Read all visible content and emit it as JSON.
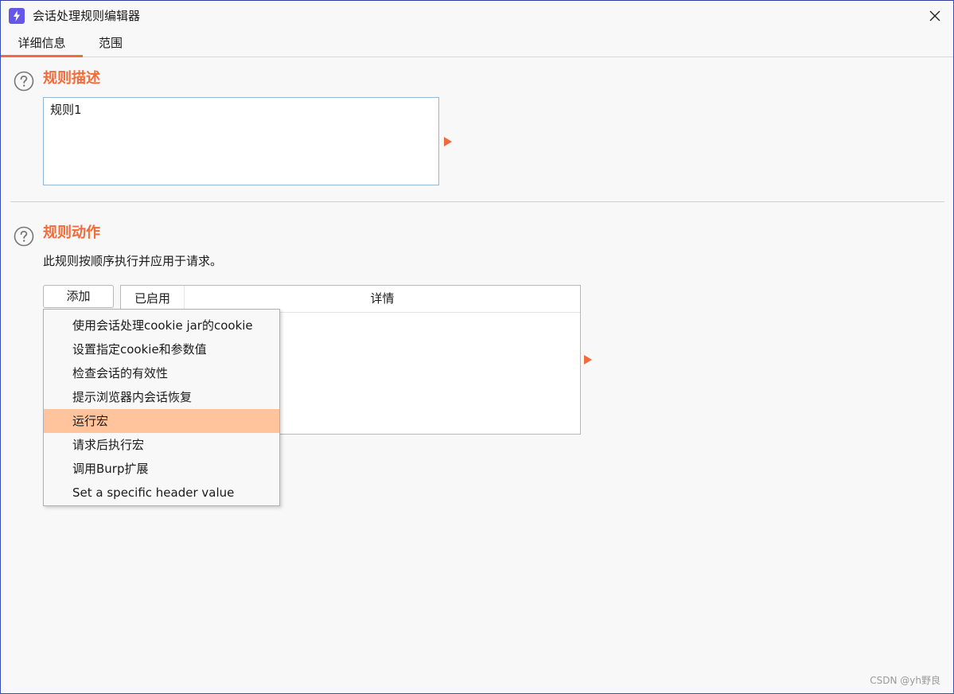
{
  "window": {
    "title": "会话处理规则编辑器"
  },
  "tabs": [
    {
      "label": "详细信息",
      "active": true
    },
    {
      "label": "范围",
      "active": false
    }
  ],
  "rule_description": {
    "title": "规则描述",
    "value": "规则1"
  },
  "rule_actions": {
    "title": "规则动作",
    "description": "此规则按顺序执行并应用于请求。",
    "add_button": "添加",
    "table": {
      "columns": [
        "已启用",
        "详情"
      ],
      "rows": []
    }
  },
  "add_menu": {
    "items": [
      {
        "label": "使用会话处理cookie jar的cookie",
        "highlighted": false
      },
      {
        "label": "设置指定cookie和参数值",
        "highlighted": false
      },
      {
        "label": "检查会话的有效性",
        "highlighted": false
      },
      {
        "label": "提示浏览器内会话恢复",
        "highlighted": false
      },
      {
        "label": "运行宏",
        "highlighted": true
      },
      {
        "label": "请求后执行宏",
        "highlighted": false
      },
      {
        "label": "调用Burp扩展",
        "highlighted": false
      },
      {
        "label": "Set a specific header value",
        "highlighted": false
      }
    ]
  },
  "watermark": "CSDN @yh野良",
  "colors": {
    "accent": "#f26b3a",
    "menu_highlight": "#ffc49b",
    "app_icon": "#6657e8"
  },
  "icons": {
    "app": "burp-lightning-icon",
    "close": "close-icon",
    "help": "question-circle-icon",
    "expand": "triangle-right-icon"
  }
}
